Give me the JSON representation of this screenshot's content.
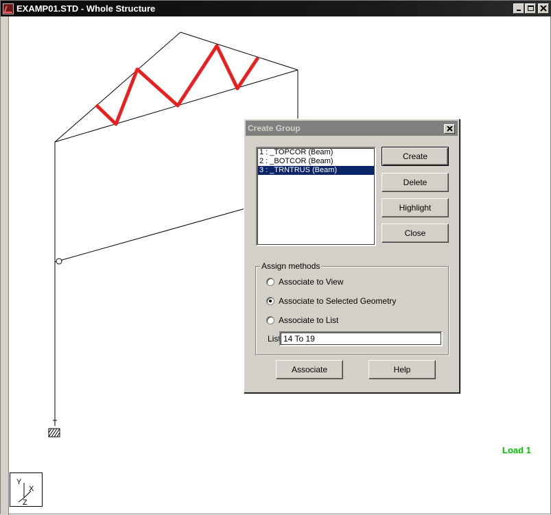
{
  "window": {
    "title": "EXAMP01.STD - Whole Structure"
  },
  "viewport": {
    "load_label": "Load 1",
    "axes": [
      "Y",
      "X",
      "Z"
    ]
  },
  "dialog": {
    "title": "Create Group",
    "groups": [
      {
        "label": "1 : _TOPCOR (Beam)",
        "selected": false
      },
      {
        "label": "2 : _BOTCOR (Beam)",
        "selected": false
      },
      {
        "label": "3 : _TRNTRUS (Beam)",
        "selected": true
      }
    ],
    "buttons": {
      "create": "Create",
      "delete": "Delete",
      "highlight": "Highlight",
      "close": "Close",
      "associate": "Associate",
      "help": "Help"
    },
    "assign_methods": {
      "title": "Assign methods",
      "options": [
        {
          "label": "Associate to View",
          "checked": false
        },
        {
          "label": "Associate to Selected Geometry",
          "checked": true
        },
        {
          "label": "Associate to List",
          "checked": false
        }
      ],
      "list_label": "List",
      "list_value": "14 To 19"
    }
  },
  "colors": {
    "highlight_members": "#e82020",
    "load_label": "#00c000",
    "selection": "#0a246a"
  }
}
